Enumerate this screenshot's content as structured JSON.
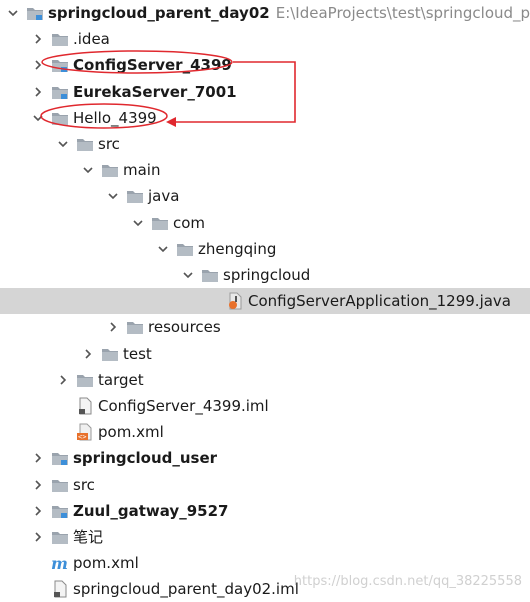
{
  "tree": [
    {
      "label": "springcloud_parent_day02",
      "path": "E:\\IdeaProjects\\test\\springcloud_pare",
      "bold": true,
      "depth": 0,
      "expand": "open",
      "icon": "module-folder"
    },
    {
      "label": ".idea",
      "depth": 1,
      "expand": "closed",
      "icon": "folder"
    },
    {
      "label": "ConfigServer_4399",
      "bold": true,
      "depth": 1,
      "expand": "closed",
      "icon": "module-folder"
    },
    {
      "label": "EurekaServer_7001",
      "bold": true,
      "depth": 1,
      "expand": "closed",
      "icon": "module-folder"
    },
    {
      "label": "Hello_4399",
      "depth": 1,
      "expand": "open",
      "icon": "folder"
    },
    {
      "label": "src",
      "depth": 2,
      "expand": "open",
      "icon": "folder"
    },
    {
      "label": "main",
      "depth": 3,
      "expand": "open",
      "icon": "folder"
    },
    {
      "label": "java",
      "depth": 4,
      "expand": "open",
      "icon": "folder"
    },
    {
      "label": "com",
      "depth": 5,
      "expand": "open",
      "icon": "folder"
    },
    {
      "label": "zhengqing",
      "depth": 6,
      "expand": "open",
      "icon": "folder"
    },
    {
      "label": "springcloud",
      "depth": 7,
      "expand": "open",
      "icon": "folder"
    },
    {
      "label": "ConfigServerApplication_1299.java",
      "depth": 8,
      "expand": "none",
      "icon": "java-file",
      "selected": true
    },
    {
      "label": "resources",
      "depth": 4,
      "expand": "closed",
      "icon": "folder"
    },
    {
      "label": "test",
      "depth": 3,
      "expand": "closed",
      "icon": "folder"
    },
    {
      "label": "target",
      "depth": 2,
      "expand": "closed",
      "icon": "folder"
    },
    {
      "label": "ConfigServer_4399.iml",
      "depth": 2,
      "expand": "none",
      "icon": "iml-file"
    },
    {
      "label": "pom.xml",
      "depth": 2,
      "expand": "none",
      "icon": "xml-file"
    },
    {
      "label": "springcloud_user",
      "bold": true,
      "depth": 1,
      "expand": "closed",
      "icon": "module-folder"
    },
    {
      "label": "src",
      "depth": 1,
      "expand": "closed",
      "icon": "folder"
    },
    {
      "label": "Zuul_gatway_9527",
      "bold": true,
      "depth": 1,
      "expand": "closed",
      "icon": "module-folder"
    },
    {
      "label": "笔记",
      "depth": 1,
      "expand": "closed",
      "icon": "folder"
    },
    {
      "label": "pom.xml",
      "depth": 1,
      "expand": "none",
      "icon": "maven-file"
    },
    {
      "label": "springcloud_parent_day02.iml",
      "depth": 1,
      "expand": "none",
      "icon": "iml-file"
    }
  ],
  "watermark": "https://blog.csdn.net/qq_38225558",
  "colors": {
    "annotation": "#e0282e",
    "selected_bg": "#d5d5d5",
    "folder": "#9aa3ad",
    "module_marker": "#3d8fd9",
    "path_text": "#8a8a8a"
  }
}
